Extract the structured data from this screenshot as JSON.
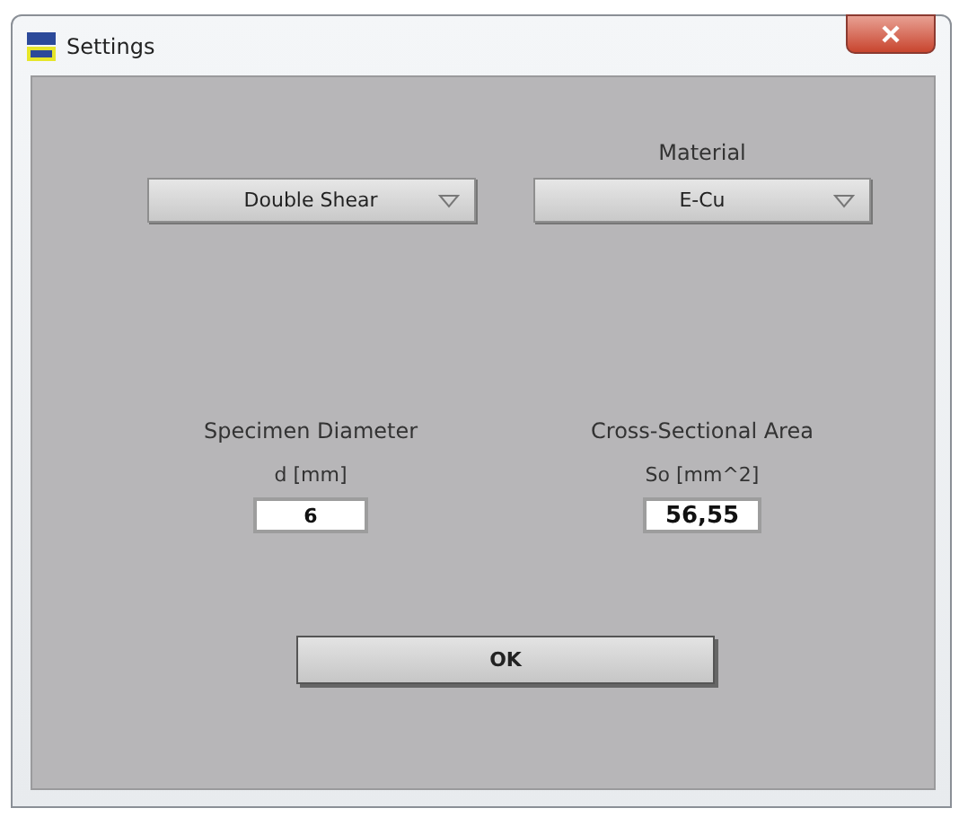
{
  "window": {
    "title": "Settings"
  },
  "selectors": [
    {
      "value": "Double Shear"
    },
    {
      "label": "Material",
      "value": "E-Cu"
    }
  ],
  "fields": [
    {
      "label": "Specimen Diameter",
      "unit": "d [mm]",
      "value": "6"
    },
    {
      "label": "Cross-Sectional Area",
      "unit": "So [mm^2]",
      "value": "56,55"
    }
  ],
  "buttons": [
    "OK"
  ]
}
